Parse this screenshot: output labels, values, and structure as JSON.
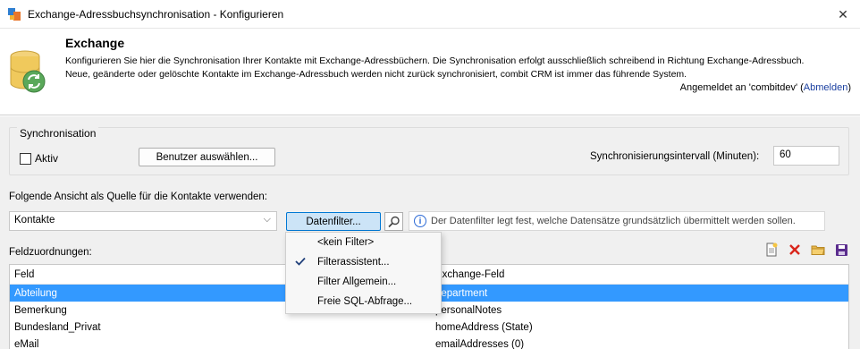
{
  "window": {
    "title": "Exchange-Adressbuchsynchronisation - Konfigurieren",
    "close_glyph": "✕"
  },
  "header": {
    "title": "Exchange",
    "description_line1": "Konfigurieren Sie hier die Synchronisation Ihrer Kontakte mit Exchange-Adressbüchern. Die Synchronisation erfolgt ausschließlich schreibend in Richtung Exchange-Adressbuch.",
    "description_line2": "Neue, geänderte oder gelöschte Kontakte im Exchange-Adressbuch werden nicht zurück synchronisiert, combit CRM ist immer das führende System.",
    "login_prefix": "Angemeldet an 'combitdev' (",
    "logout_label": "Abmelden",
    "login_suffix": ")",
    "icon": "database-sync-icon"
  },
  "sync": {
    "legend": "Synchronisation",
    "active_label": "Aktiv",
    "active_checked": false,
    "users_button": "Benutzer auswählen...",
    "interval_label": "Synchronisierungsintervall (Minuten):",
    "interval_value": "60"
  },
  "source": {
    "label": "Folgende Ansicht als Quelle für die Kontakte verwenden:",
    "selected_view": "Kontakte",
    "filter_button": "Datenfilter...",
    "info_text": "Der Datenfilter legt fest, welche Datensätze grundsätzlich übermittelt werden sollen."
  },
  "filter_menu": {
    "items": [
      {
        "label": "<kein Filter>",
        "checked": false
      },
      {
        "label": "Filterassistent...",
        "checked": true
      },
      {
        "label": "Filter Allgemein...",
        "checked": false
      },
      {
        "label": "Freie SQL-Abfrage...",
        "checked": false
      }
    ]
  },
  "fields": {
    "label": "Feldzuordnungen:",
    "columns": [
      "Feld",
      "Exchange-Feld"
    ],
    "rows": [
      {
        "feld": "Abteilung",
        "exchange": "department",
        "selected": true
      },
      {
        "feld": "Bemerkung",
        "exchange": "personalNotes",
        "selected": false
      },
      {
        "feld": "Bundesland_Privat",
        "exchange": "homeAddress (State)",
        "selected": false
      },
      {
        "feld": "eMail",
        "exchange": "emailAddresses (0)",
        "selected": false
      }
    ]
  },
  "colors": {
    "accent": "#0078d4",
    "selection": "#3399ff",
    "link": "#1a3fa0",
    "delete_red": "#d9261c",
    "save_purple": "#5b2d8e",
    "folder_yellow": "#e8b64a"
  }
}
